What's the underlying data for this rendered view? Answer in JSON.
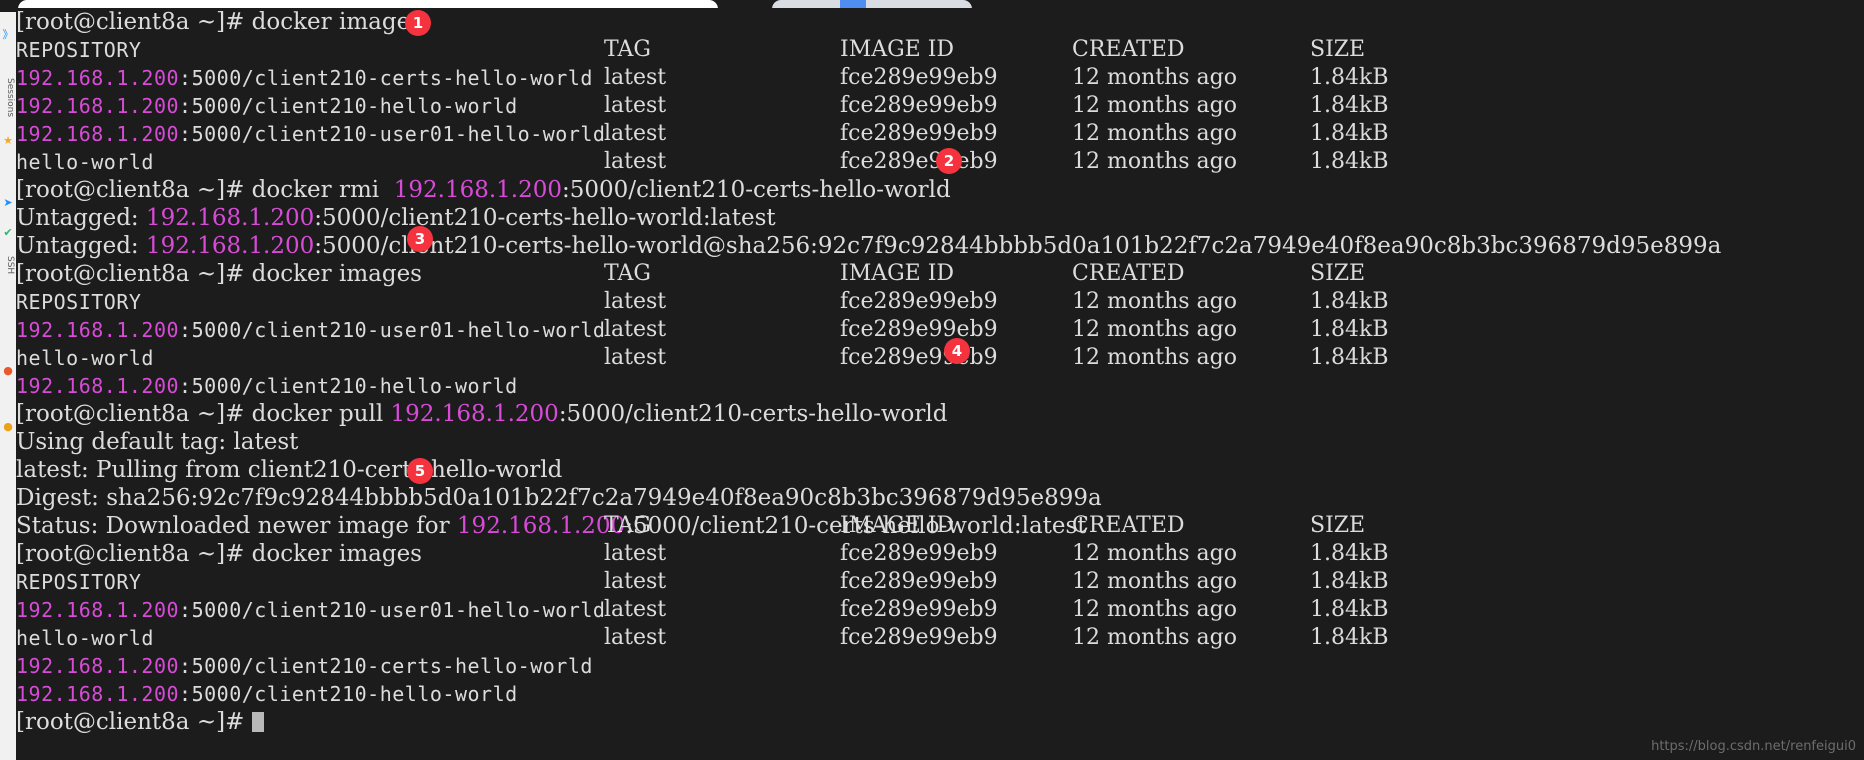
{
  "window": {
    "title_bar_visible": true
  },
  "sidebar": {
    "icons": [
      {
        "name": "chevron-right-icon",
        "glyph": "》"
      },
      {
        "name": "star-icon",
        "glyph": "★"
      },
      {
        "name": "arrow-right-icon",
        "glyph": "➤"
      },
      {
        "name": "check-icon",
        "glyph": "✔"
      },
      {
        "name": "record-dot-icon",
        "glyph": "●"
      },
      {
        "name": "record-dot-icon-2",
        "glyph": "●"
      }
    ],
    "vertical_label_1": "Sessions",
    "vertical_label_2": "SSH"
  },
  "prompt": "[root@client8a ~]# ",
  "registry_host": "192.168.1.200",
  "colors": {
    "background": "#1c1c1c",
    "foreground": "#d6d6d6",
    "magenta": "#d74bd7",
    "marker": "#f5333f",
    "cursor": "#b9b9b9"
  },
  "headers": {
    "repository": "REPOSITORY",
    "tag": "TAG",
    "image_id": "IMAGE ID",
    "created": "CREATED",
    "size": "SIZE"
  },
  "markers": [
    {
      "id": 1,
      "label": "1"
    },
    {
      "id": 2,
      "label": "2"
    },
    {
      "id": 3,
      "label": "3"
    },
    {
      "id": 4,
      "label": "4"
    },
    {
      "id": 5,
      "label": "5"
    }
  ],
  "commands": {
    "docker_images": "docker images",
    "docker_rmi": "docker rmi  ",
    "docker_pull": "docker pull ",
    "rmi_target": ":5000/client210-certs-hello-world",
    "pull_target": ":5000/client210-certs-hello-world"
  },
  "digest": "sha256:92c7f9c92844bbbb5d0a101b22f7c2a7949e40f8ea90c8b3bc396879d95e899a",
  "digest_hash_only": "92c7f9c92844bbbb5d0a101b22f7c2a7949e40f8ea90c8b3bc396879d95e899a",
  "output": {
    "untagged_1_prefix": "Untagged: ",
    "untagged_1_suffix": ":5000/client210-certs-hello-world:latest",
    "untagged_2_prefix": "Untagged: ",
    "untagged_2_suffix": ":5000/client210-certs-hello-world@sha256:92c7f9c92844bbbb5d0a101b22f7c2a7949e40f8ea90c8b3bc396879d95e899a",
    "using_default_tag": "Using default tag: latest",
    "pulling_from": "latest: Pulling from client210-certs-hello-world",
    "digest_line": "Digest: sha256:92c7f9c92844bbbb5d0a101b22f7c2a7949e40f8ea90c8b3bc396879d95e899a",
    "status_prefix": "Status: Downloaded newer image for ",
    "status_suffix": ":5000/client210-certs-hello-world:latest"
  },
  "tables": [
    {
      "id": "images-before-rmi",
      "rows": [
        {
          "repo_host": "192.168.1.200",
          "repo_rest": ":5000/client210-certs-hello-world",
          "tag": "latest",
          "image_id": "fce289e99eb9",
          "created": "12 months ago",
          "size": "1.84kB"
        },
        {
          "repo_host": "192.168.1.200",
          "repo_rest": ":5000/client210-hello-world",
          "tag": "latest",
          "image_id": "fce289e99eb9",
          "created": "12 months ago",
          "size": "1.84kB"
        },
        {
          "repo_host": "192.168.1.200",
          "repo_rest": ":5000/client210-user01-hello-world",
          "tag": "latest",
          "image_id": "fce289e99eb9",
          "created": "12 months ago",
          "size": "1.84kB"
        },
        {
          "repo_host": "",
          "repo_rest": "hello-world",
          "tag": "latest",
          "image_id": "fce289e99eb9",
          "created": "12 months ago",
          "size": "1.84kB"
        }
      ]
    },
    {
      "id": "images-after-rmi",
      "rows": [
        {
          "repo_host": "192.168.1.200",
          "repo_rest": ":5000/client210-user01-hello-world",
          "tag": "latest",
          "image_id": "fce289e99eb9",
          "created": "12 months ago",
          "size": "1.84kB"
        },
        {
          "repo_host": "",
          "repo_rest": "hello-world",
          "tag": "latest",
          "image_id": "fce289e99eb9",
          "created": "12 months ago",
          "size": "1.84kB"
        },
        {
          "repo_host": "192.168.1.200",
          "repo_rest": ":5000/client210-hello-world",
          "tag": "latest",
          "image_id": "fce289e99eb9",
          "created": "12 months ago",
          "size": "1.84kB"
        }
      ]
    },
    {
      "id": "images-after-pull",
      "rows": [
        {
          "repo_host": "192.168.1.200",
          "repo_rest": ":5000/client210-user01-hello-world",
          "tag": "latest",
          "image_id": "fce289e99eb9",
          "created": "12 months ago",
          "size": "1.84kB"
        },
        {
          "repo_host": "",
          "repo_rest": "hello-world",
          "tag": "latest",
          "image_id": "fce289e99eb9",
          "created": "12 months ago",
          "size": "1.84kB"
        },
        {
          "repo_host": "192.168.1.200",
          "repo_rest": ":5000/client210-certs-hello-world",
          "tag": "latest",
          "image_id": "fce289e99eb9",
          "created": "12 months ago",
          "size": "1.84kB"
        },
        {
          "repo_host": "192.168.1.200",
          "repo_rest": ":5000/client210-hello-world",
          "tag": "latest",
          "image_id": "fce289e99eb9",
          "created": "12 months ago",
          "size": "1.84kB"
        }
      ]
    }
  ],
  "watermark": "https://blog.csdn.net/renfeigui0"
}
